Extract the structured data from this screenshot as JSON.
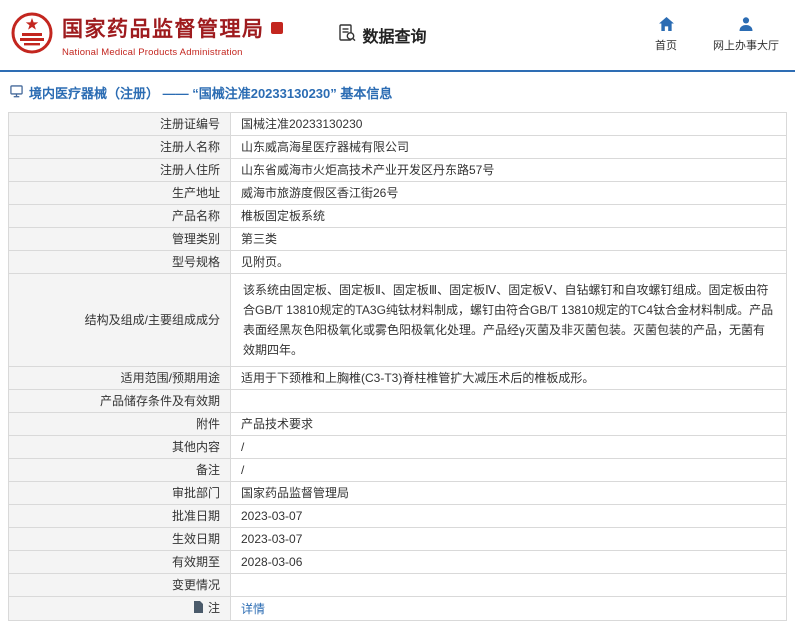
{
  "colors": {
    "brand_red": "#9e1b1e",
    "accent_red": "#c3261f",
    "accent_blue": "#2b6cb3",
    "header_line_blue": "#2e6db4",
    "table_border": "#d9d9d9",
    "label_bg": "#f4f4f4"
  },
  "icons": {
    "logo": "nmpa-emblem-logo",
    "seal": "seal-icon",
    "query": "document-search-icon",
    "home": "home-icon",
    "hall": "person-icon",
    "page_title": "document-icon",
    "note": "note-icon"
  },
  "header": {
    "agency_cn": "国家药品监督管理局",
    "agency_en": "National Medical Products Administration",
    "nav_query": "数据查询",
    "nav_home": "首页",
    "nav_hall": "网上办事大厅"
  },
  "page": {
    "title": "境内医疗器械（注册） —— “国械注准20233130230” 基本信息"
  },
  "table": {
    "rows": [
      {
        "label": "注册证编号",
        "value": "国械注准20233130230"
      },
      {
        "label": "注册人名称",
        "value": "山东威高海星医疗器械有限公司"
      },
      {
        "label": "注册人住所",
        "value": "山东省威海市火炬高技术产业开发区丹东路57号"
      },
      {
        "label": "生产地址",
        "value": "威海市旅游度假区香江街26号"
      },
      {
        "label": "产品名称",
        "value": "椎板固定板系统"
      },
      {
        "label": "管理类别",
        "value": "第三类"
      },
      {
        "label": "型号规格",
        "value": "见附页。"
      },
      {
        "label": "结构及组成/主要组成成分",
        "value": "该系统由固定板、固定板Ⅱ、固定板Ⅲ、固定板Ⅳ、固定板Ⅴ、自钻螺钉和自攻螺钉组成。固定板由符合GB/T 13810规定的TA3G纯钛材料制成，螺钉由符合GB/T 13810规定的TC4钛合金材料制成。产品表面经黑灰色阳极氧化或雾色阳极氧化处理。产品经γ灭菌及非灭菌包装。灭菌包装的产品，无菌有效期四年。",
        "multiline": true
      },
      {
        "label": "适用范围/预期用途",
        "value": "适用于下颈椎和上胸椎(C3-T3)脊柱椎管扩大减压术后的椎板成形。"
      },
      {
        "label": "产品储存条件及有效期",
        "value": ""
      },
      {
        "label": "附件",
        "value": "产品技术要求"
      },
      {
        "label": "其他内容",
        "value": "/"
      },
      {
        "label": "备注",
        "value": "/"
      },
      {
        "label": "审批部门",
        "value": "国家药品监督管理局"
      },
      {
        "label": "批准日期",
        "value": "2023-03-07"
      },
      {
        "label": "生效日期",
        "value": "2023-03-07"
      },
      {
        "label": "有效期至",
        "value": "2028-03-06"
      },
      {
        "label": "变更情况",
        "value": ""
      },
      {
        "label": "注",
        "value": "详情",
        "link": true,
        "icon": "note-icon"
      }
    ]
  }
}
